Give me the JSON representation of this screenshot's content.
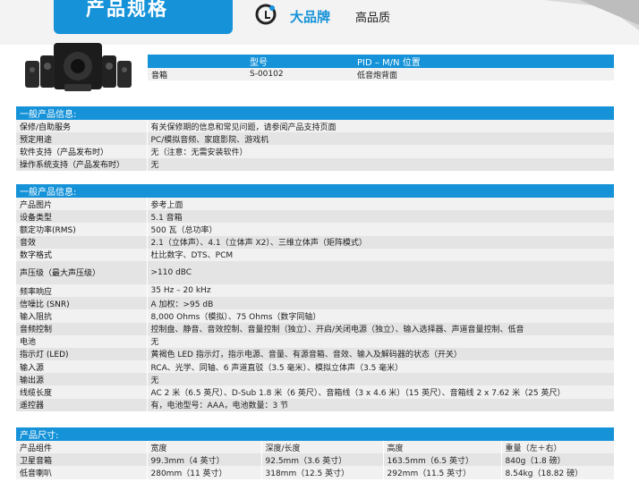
{
  "header": {
    "title": "产品规格",
    "brand_name": "大品牌",
    "brand_desc": "高品质"
  },
  "model_table": {
    "headers": [
      "",
      "型号",
      "PID – M/N 位置"
    ],
    "row": [
      "音箱",
      "S-00102",
      "低音炮背面"
    ]
  },
  "section1": {
    "title": "一般产品信息:",
    "rows": [
      [
        "保修/自助服务",
        "有关保修期的信息和常见问题，请参阅产品支持页面"
      ],
      [
        "预定用途",
        "PC/模拟音频、家庭影院、游戏机"
      ],
      [
        "软件支持（产品发布时）",
        "无（注意：无需安装软件）"
      ],
      [
        "操作系统支持（产品发布时）",
        "无"
      ]
    ]
  },
  "section2": {
    "title": "一般产品信息:",
    "rows": [
      [
        "产品图片",
        "参考上面"
      ],
      [
        "设备类型",
        "5.1 音箱"
      ],
      [
        "额定功率(RMS)",
        "500 瓦（总功率）"
      ],
      [
        "音效",
        "2.1（立体声）、4.1（立体声 X2）、三维立体声（矩阵模式）"
      ],
      [
        "数字格式",
        "杜比数字、DTS、PCM"
      ],
      [
        "声压级（最大声压级）",
        ">110 dBC"
      ],
      [
        "频率响应",
        "35 Hz – 20 kHz"
      ],
      [
        "信噪比 (SNR)",
        "A 加权：>95 dB"
      ],
      [
        "输入阻抗",
        "8,000 Ohms（模拟）、75 Ohms（数字同轴）"
      ],
      [
        "音频控制",
        "控制盘、静音、音效控制、音量控制（独立）、开启/关闭电源（独立）、输入选择器、声道音量控制、低音"
      ],
      [
        "电池",
        "无"
      ],
      [
        "指示灯 (LED)",
        "黄褐色 LED 指示灯，指示电源、音量、有源音箱、音效、输入及解码器的状态（开关）"
      ],
      [
        "输入源",
        "RCA、光学、同轴、6 声道直驳（3.5 毫米）、模拟立体声（3.5 毫米）"
      ],
      [
        "输出源",
        "无"
      ],
      [
        "线缆长度",
        "AC 2 米（6.5 英尺）、D-Sub 1.8 米（6 英尺）、音箱线（3 x 4.6 米）（15 英尺）、音箱线 2 x 7.62 米（25 英尺）"
      ],
      [
        "遥控器",
        "有，电池型号：AAA，电池数量：3 节"
      ]
    ]
  },
  "section3": {
    "title": "产品尺寸:",
    "headers": [
      "产品组件",
      "宽度",
      "深度/长度",
      "高度",
      "重量（左＋右）"
    ],
    "rows": [
      [
        "卫星音箱",
        "99.3mm（4 英寸）",
        "92.5mm（3.6 英寸）",
        "163.5mm（6.5 英寸）",
        "840g（1.8 磅）"
      ],
      [
        "低音喇叭",
        "280mm（11 英寸）",
        "318mm（12.5 英寸）",
        "292mm（11.5 英寸）",
        "8.54kg（18.82 磅）"
      ]
    ]
  },
  "colors": {
    "accent": "#1592d8"
  }
}
